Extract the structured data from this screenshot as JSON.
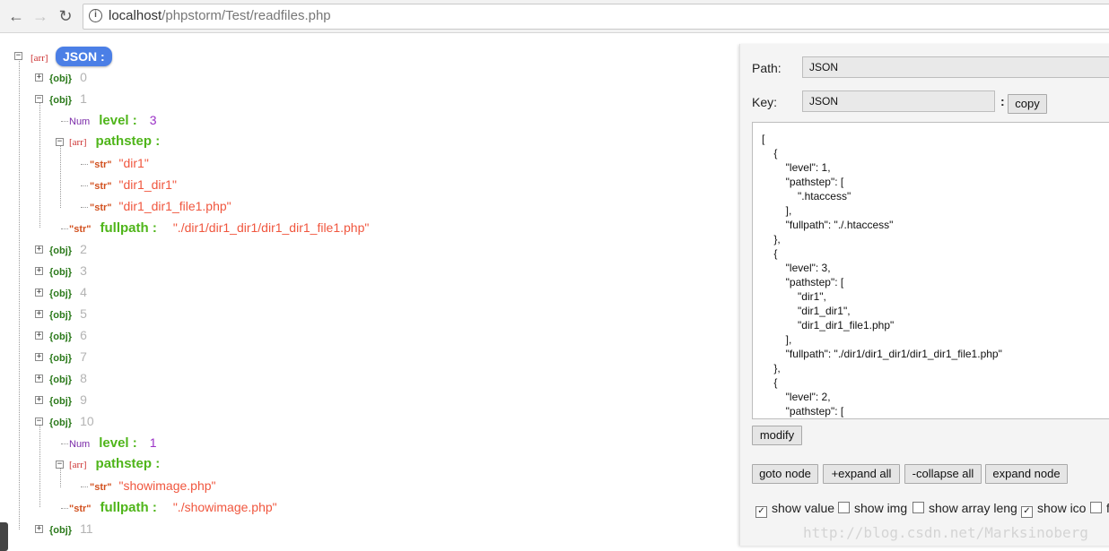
{
  "browser": {
    "url_host": "localhost",
    "url_path": "/phpstorm/Test/readfiles.php"
  },
  "tree": {
    "root": {
      "type": "[arr]",
      "label": "JSON :"
    },
    "rows": [
      {
        "type": "{obj}",
        "text": "0"
      },
      {
        "type": "{obj}",
        "text": "1"
      },
      {
        "type": "Num",
        "key": "level :",
        "value": "3"
      },
      {
        "type": "[arr]",
        "key": "pathstep :"
      },
      {
        "type": "\"str\"",
        "value": "\"dir1\""
      },
      {
        "type": "\"str\"",
        "value": "\"dir1_dir1\""
      },
      {
        "type": "\"str\"",
        "value": "\"dir1_dir1_file1.php\""
      },
      {
        "type": "\"str\"",
        "key": "fullpath :",
        "value": "\"./dir1/dir1_dir1/dir1_dir1_file1.php\""
      },
      {
        "type": "{obj}",
        "text": "2"
      },
      {
        "type": "{obj}",
        "text": "3"
      },
      {
        "type": "{obj}",
        "text": "4"
      },
      {
        "type": "{obj}",
        "text": "5"
      },
      {
        "type": "{obj}",
        "text": "6"
      },
      {
        "type": "{obj}",
        "text": "7"
      },
      {
        "type": "{obj}",
        "text": "8"
      },
      {
        "type": "{obj}",
        "text": "9"
      },
      {
        "type": "{obj}",
        "text": "10"
      },
      {
        "type": "Num",
        "key": "level :",
        "value": "1"
      },
      {
        "type": "[arr]",
        "key": "pathstep :"
      },
      {
        "type": "\"str\"",
        "value": "\"showimage.php\""
      },
      {
        "type": "\"str\"",
        "key": "fullpath :",
        "value": "\"./showimage.php\""
      },
      {
        "type": "{obj}",
        "text": "11"
      }
    ]
  },
  "panel": {
    "path_label": "Path:",
    "path_value": "JSON",
    "key_label": "Key:",
    "key_value": "JSON",
    "key_sep": ":",
    "copy_label": "copy",
    "json_text": "[\n    {\n        \"level\": 1,\n        \"pathstep\": [\n            \".htaccess\"\n        ],\n        \"fullpath\": \"./.htaccess\"\n    },\n    {\n        \"level\": 3,\n        \"pathstep\": [\n            \"dir1\",\n            \"dir1_dir1\",\n            \"dir1_dir1_file1.php\"\n        ],\n        \"fullpath\": \"./dir1/dir1_dir1/dir1_dir1_file1.php\"\n    },\n    {\n        \"level\": 2,\n        \"pathstep\": [",
    "modify_label": "modify",
    "goto_label": "goto node",
    "expand_all_label": "+expand all",
    "collapse_all_label": "-collapse all",
    "expand_node_label": "expand node",
    "options": [
      {
        "label": "show value",
        "checked": true
      },
      {
        "label": "show img",
        "checked": false
      },
      {
        "label": "show array leng",
        "checked": false
      },
      {
        "label": "show ico",
        "checked": true
      },
      {
        "label": "fo",
        "checked": false
      }
    ]
  },
  "watermark": "http://blog.csdn.net/Marksinoberg"
}
